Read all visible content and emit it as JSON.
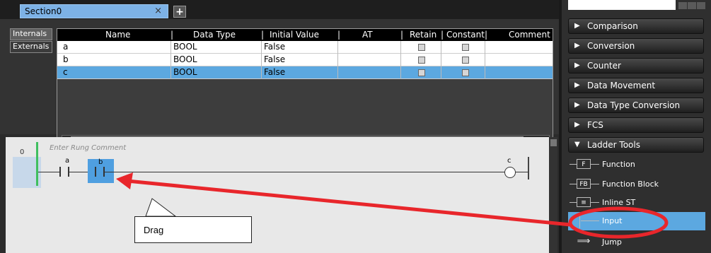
{
  "editor": {
    "tab_title": "Section0",
    "tab_close": "×",
    "tab_add": "+"
  },
  "variables": {
    "side_tabs": [
      "Internals",
      "Externals"
    ],
    "columns": [
      "Name",
      "Data Type",
      "Initial Value",
      "AT",
      "Retain",
      "Constant",
      "Comment"
    ],
    "rows": [
      {
        "name": "a",
        "data_type": "BOOL",
        "initial_value": "False",
        "retain": false,
        "constant": false
      },
      {
        "name": "b",
        "data_type": "BOOL",
        "initial_value": "False",
        "retain": false,
        "constant": false
      },
      {
        "name": "c",
        "data_type": "BOOL",
        "initial_value": "False",
        "retain": false,
        "constant": false
      }
    ],
    "selected_row": 2
  },
  "ladder": {
    "rung_number": "0",
    "rung_comment_placeholder": "Enter Rung Comment",
    "contact_a_label": "a",
    "contact_b_label": "b",
    "coil_label": "c"
  },
  "callout": {
    "text": "Drag"
  },
  "toolbox": {
    "categories": [
      {
        "label": "Comparison",
        "expanded": false
      },
      {
        "label": "Conversion",
        "expanded": false
      },
      {
        "label": "Counter",
        "expanded": false
      },
      {
        "label": "Data Movement",
        "expanded": false
      },
      {
        "label": "Data Type Conversion",
        "expanded": false
      },
      {
        "label": "FCS",
        "expanded": false
      },
      {
        "label": "Ladder Tools",
        "expanded": true
      }
    ],
    "ladder_tools": [
      {
        "label": "Function",
        "icon_text": "F",
        "icon": "function-icon"
      },
      {
        "label": "Function Block",
        "icon_text": "FB",
        "icon": "function-block-icon"
      },
      {
        "label": "Inline ST",
        "icon_text": "",
        "icon": "inline-st-icon"
      },
      {
        "label": "Input",
        "icon_text": "",
        "icon": "input-contact-icon",
        "selected": true
      },
      {
        "label": "Jump",
        "icon_text": "",
        "icon": "jump-icon"
      }
    ],
    "arrow_collapsed": "▶",
    "arrow_expanded": "▼"
  },
  "colors": {
    "selection": "#5ca8e0",
    "annotation": "#e8262b",
    "rail_green": "#3fbf5f"
  }
}
